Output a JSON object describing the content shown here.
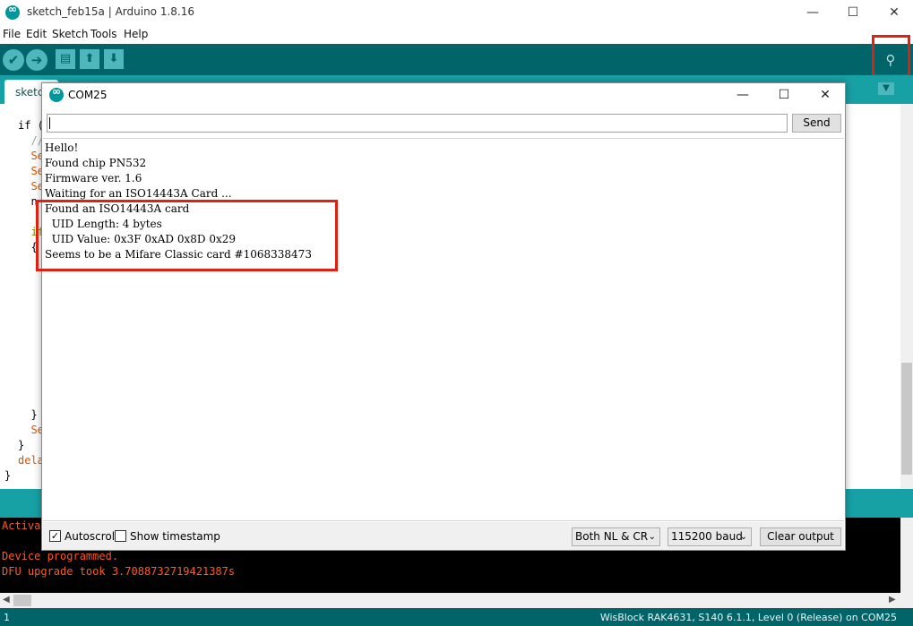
{
  "window": {
    "title": "sketch_feb15a | Arduino 1.8.16",
    "minimize": "—",
    "maximize": "☐",
    "close": "✕"
  },
  "menu": [
    "File",
    "Edit",
    "Sketch",
    "Tools",
    "Help"
  ],
  "toolbar": {
    "verify_icon": "✔",
    "upload_icon": "➔",
    "new_icon": "▤",
    "open_icon": "⬆",
    "save_icon": "⬇",
    "serial_monitor_icon": "⚲"
  },
  "tab": {
    "label": "sketc",
    "menu_icon": "▼"
  },
  "editor": {
    "lines": [
      {
        "text": "if (",
        "color": "#000000"
      },
      {
        "text": "  //",
        "color": "#95a5a6"
      },
      {
        "text": "  Se",
        "color": "#d35400"
      },
      {
        "text": "  Se",
        "color": "#d35400"
      },
      {
        "text": "  Se",
        "color": "#d35400"
      },
      {
        "text": "  n",
        "color": "#000000"
      },
      {
        "text": "  if",
        "color": "#728e00"
      },
      {
        "text": "  {",
        "color": "#000000"
      },
      {
        "text": "  }",
        "color": "#000000"
      },
      {
        "text": "  Se",
        "color": "#d35400"
      },
      {
        "text": "}",
        "color": "#000000"
      },
      {
        "text": "dela",
        "color": "#d35400"
      },
      {
        "text": "}",
        "color": "#000000"
      }
    ]
  },
  "console": {
    "lines": [
      "Activat",
      "Device programmed.",
      "DFU upgrade took 3.7088732719421387s"
    ]
  },
  "footer": {
    "line_number": "1",
    "board_info": "WisBlock RAK4631, S140 6.1.1, Level 0 (Release) on COM25"
  },
  "serial_monitor": {
    "title": "COM25",
    "input_value": "",
    "send_label": "Send",
    "output_lines": [
      "Hello!",
      "Found chip PN532",
      "Firmware ver. 1.6",
      "Waiting for an ISO14443A Card ...",
      "Found an ISO14443A card",
      "  UID Length: 4 bytes",
      "  UID Value: 0x3F 0xAD 0x8D 0x29",
      "Seems to be a Mifare Classic card #1068338473"
    ],
    "autoscroll_label": "Autoscroll",
    "autoscroll_checked": true,
    "timestamp_label": "Show timestamp",
    "timestamp_checked": false,
    "line_ending": "Both NL & CR",
    "baud_rate": "115200 baud",
    "clear_label": "Clear output"
  },
  "colors": {
    "toolbar": "#006468",
    "tabstrip": "#17a1a5",
    "highlight": "#e02010",
    "console_text": "#ff5a20"
  }
}
